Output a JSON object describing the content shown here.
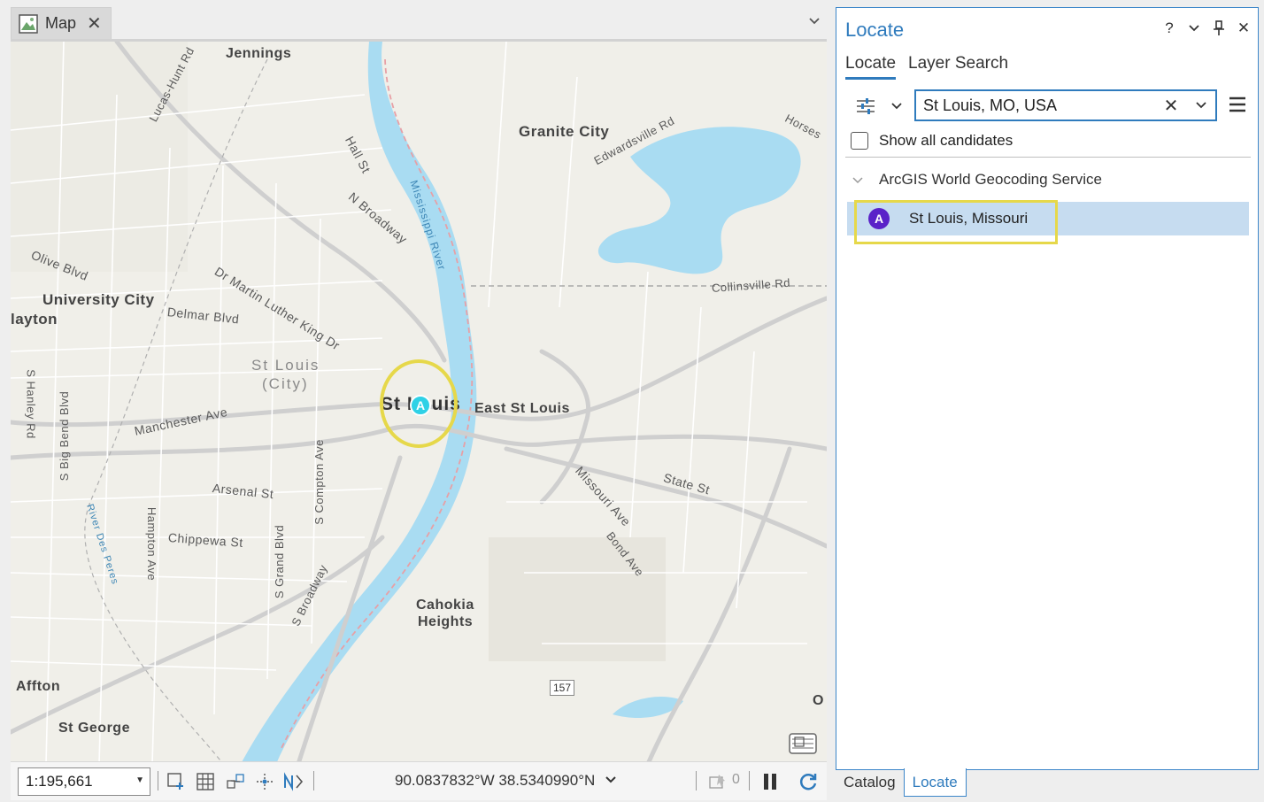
{
  "map_tab": {
    "label": "Map",
    "close": "✕"
  },
  "map": {
    "labels": {
      "jennings": "Jennings",
      "lucas_hunt": "Lucas-Hunt Rd",
      "hall_st": "Hall St",
      "n_broadway": "N Broadway",
      "mississippi": "Mississippi River",
      "granite_city": "Granite City",
      "edwardsville": "Edwardsville Rd",
      "horseshoe": "Horses",
      "olive": "Olive Blvd",
      "mlk": "Dr Martin Luther King Dr",
      "university_city": "University City",
      "delmar": "Delmar Blvd",
      "clayton": "layton",
      "collinsville": "Collinsville Rd",
      "st_louis_city": "St Louis",
      "st_louis_city2": "(City)",
      "st_louis": "St Louis",
      "east_st_louis": "East St Louis",
      "s_hanley": "S Hanley Rd",
      "s_big_bend": "S Big Bend Blvd",
      "manchester": "Manchester Ave",
      "s_compton": "S Compton Ave",
      "arsenal": "Arsenal St",
      "missouri_ave": "Missouri Ave",
      "state_st": "State St",
      "river_des_peres": "River Des Peres",
      "hampton": "Hampton Ave",
      "chippewa": "Chippewa St",
      "s_grand": "S Grand Blvd",
      "s_broadway": "S Broadway",
      "bond_ave": "Bond Ave",
      "cahokia": "Cahokia",
      "heights": "Heights",
      "route": "157",
      "affton": "Affton",
      "st_george": "St George",
      "edge_o": "O"
    },
    "marker_letter": "A"
  },
  "status_bar": {
    "scale": "1:195,661",
    "coordinates": "90.0837832°W 38.5340990°N",
    "selection_count": "0"
  },
  "pane": {
    "title": "Locate",
    "controls": {
      "help": "?",
      "options": "⌄",
      "pin": "🖈",
      "close": "✕"
    },
    "tabs": [
      "Locate",
      "Layer Search"
    ],
    "search": {
      "value": "St Louis, MO, USA",
      "clear": "✕"
    },
    "show_all_label": "Show all candidates",
    "group_label": "ArcGIS World Geocoding Service",
    "result": {
      "badge": "A",
      "label": "St Louis, Missouri"
    }
  },
  "bottom_tabs": [
    "Catalog",
    "Locate"
  ]
}
